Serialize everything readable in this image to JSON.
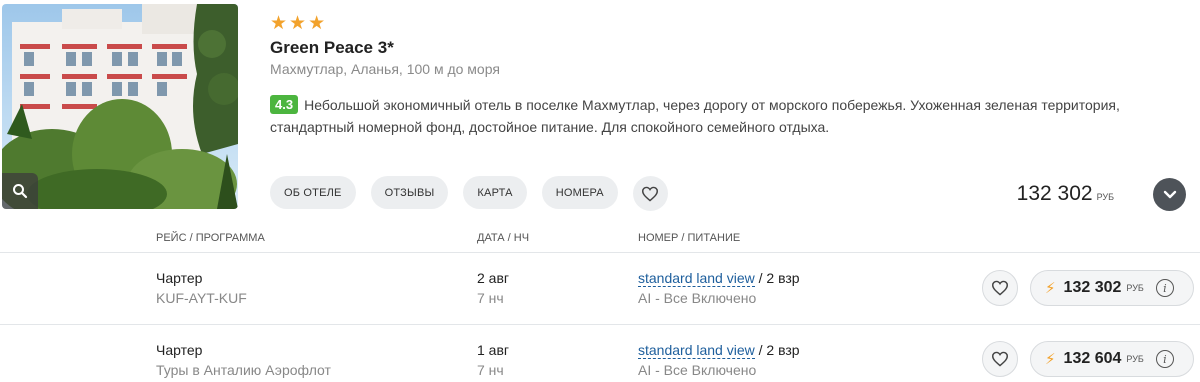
{
  "hotel": {
    "stars": [
      "★",
      "★",
      "★"
    ],
    "name": "Green Peace 3*",
    "location": "Махмутлар, Аланья, 100 м до моря",
    "rating": "4.3",
    "description": "Небольшой экономичный отель в поселке Махмутлар, через дорогу от морского побережья. Ухоженная зеленая территория, стандартный номерной фонд, достойное питание. Для спокойного семейного отдыха.",
    "tabs": [
      "ОБ ОТЕЛЕ",
      "ОТЗЫВЫ",
      "КАРТА",
      "НОМЕРА"
    ],
    "total_price": "132 302",
    "currency": "РУБ"
  },
  "columns": {
    "flight": "РЕЙС / ПРОГРАММА",
    "date": "ДАТА / НЧ",
    "room": "НОМЕР / ПИТАНИЕ"
  },
  "offers": [
    {
      "type": "Чартер",
      "program": "KUF-AYT-KUF",
      "date": "2 авг",
      "nights": "7 нч",
      "room": "standard land view",
      "occupancy": " / 2 взр",
      "meal": "AI - Все Включено",
      "price": "132 302",
      "currency": "РУБ"
    },
    {
      "type": "Чартер",
      "program": "Туры в Анталию Аэрофлот",
      "date": "1 авг",
      "nights": "7 нч",
      "room": "standard land view",
      "occupancy": " / 2 взр",
      "meal": "AI - Все Включено",
      "price": "132 604",
      "currency": "РУБ"
    }
  ],
  "icons": {
    "zoom": "magnifier-icon",
    "favorite": "heart-icon",
    "expand": "chevron-down-icon",
    "bolt": "lightning-icon",
    "info": "info-icon"
  },
  "colors": {
    "star": "#f2a22c",
    "rating_bg": "#4cb53f",
    "link": "#1d5e9c",
    "expand_bg": "#4e5359"
  }
}
